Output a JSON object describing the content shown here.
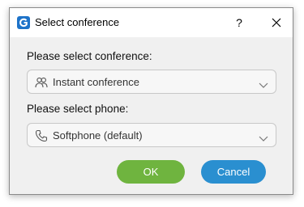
{
  "window": {
    "title": "Select conference",
    "help_label": "?"
  },
  "conference": {
    "label": "Please select conference:",
    "selected": "Instant conference",
    "icon": "people-icon"
  },
  "phone": {
    "label": "Please select phone:",
    "selected": "Softphone (default)",
    "icon": "phone-icon"
  },
  "buttons": {
    "ok_label": "OK",
    "cancel_label": "Cancel"
  },
  "colors": {
    "ok_button": "#6fb43f",
    "cancel_button": "#2a8fd0",
    "app_icon": "#1e73c9"
  }
}
